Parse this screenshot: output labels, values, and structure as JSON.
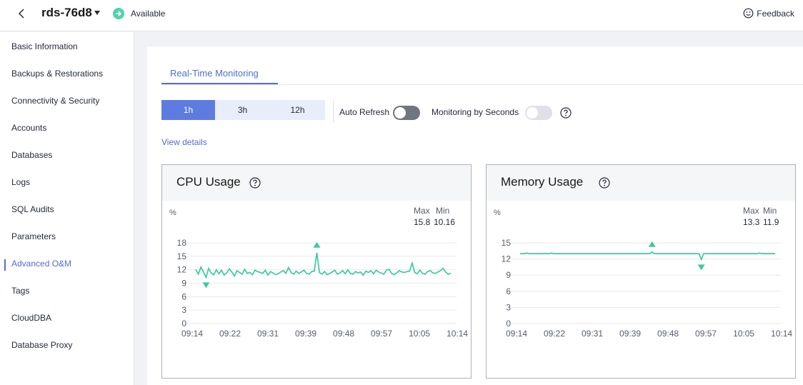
{
  "header": {
    "instance_name": "rds-76d8",
    "status": "Available",
    "feedback_label": "Feedback"
  },
  "sidebar": {
    "items": [
      {
        "label": "Basic Information"
      },
      {
        "label": "Backups & Restorations"
      },
      {
        "label": "Connectivity & Security"
      },
      {
        "label": "Accounts"
      },
      {
        "label": "Databases"
      },
      {
        "label": "Logs"
      },
      {
        "label": "SQL Audits"
      },
      {
        "label": "Parameters"
      },
      {
        "label": "Advanced O&M",
        "active": true
      },
      {
        "label": "Tags"
      },
      {
        "label": "CloudDBA"
      },
      {
        "label": "Database Proxy"
      }
    ]
  },
  "main": {
    "tab": "Real-Time Monitoring",
    "ranges": [
      "1h",
      "3h",
      "12h"
    ],
    "active_range": "1h",
    "auto_refresh_label": "Auto Refresh",
    "auto_refresh_on": false,
    "monitoring_by_seconds_label": "Monitoring by Seconds",
    "monitoring_by_seconds_enabled": false,
    "view_details_label": "View details"
  },
  "colors": {
    "accent": "#526ecc",
    "active_button": "#5e7ce0",
    "series": "#3ec9a0",
    "status_ok": "#50d4ab"
  },
  "chart_data": [
    {
      "type": "line",
      "title": "CPU Usage",
      "ylabel": "%",
      "max_label": "Max",
      "min_label": "Min",
      "max": "15.8",
      "min": "10.16",
      "ylim": [
        0,
        18
      ],
      "yticks": [
        0,
        3,
        6,
        9,
        12,
        15,
        18
      ],
      "xtick_labels": [
        "09:14",
        "09:22",
        "09:31",
        "09:39",
        "09:48",
        "09:57",
        "10:05",
        "10:14"
      ],
      "series": [
        {
          "values": [
            12.1,
            11.0,
            12.6,
            11.5,
            10.3,
            12.3,
            11.3,
            10.9,
            12.0,
            11.1,
            11.9,
            10.8,
            11.3,
            12.2,
            11.5,
            10.6,
            11.8,
            11.4,
            11.0,
            12.1,
            11.2,
            11.4,
            10.9,
            11.9,
            11.6,
            11.4,
            11.2,
            11.9,
            10.8,
            11.6,
            11.3,
            10.9,
            11.1,
            11.5,
            11.8,
            11.2,
            12.5,
            11.4,
            11.0,
            11.7,
            11.2,
            11.5,
            11.9,
            11.2,
            11.0,
            11.6,
            11.7,
            15.8,
            11.4,
            11.0,
            11.6,
            10.9,
            11.2,
            11.5,
            11.9,
            11.0,
            11.3,
            11.8,
            11.1,
            12.0,
            11.2,
            11.0,
            11.6,
            11.3,
            11.5,
            10.8,
            11.7,
            11.4,
            11.8,
            11.1,
            11.9,
            11.5,
            11.3,
            11.0,
            11.9,
            12.1,
            11.2,
            10.9,
            11.3,
            11.8,
            11.5,
            11.4,
            11.6,
            11.7,
            13.5,
            11.4,
            11.1,
            11.9,
            11.2,
            11.0,
            11.6,
            11.8,
            11.3,
            11.2,
            11.5,
            11.8,
            12.3,
            11.5,
            11.0,
            11.2
          ]
        }
      ],
      "max_index": 47,
      "min_index": 4
    },
    {
      "type": "line",
      "title": "Memory Usage",
      "ylabel": "%",
      "max_label": "Max",
      "min_label": "Min",
      "max": "13.3",
      "min": "11.9",
      "ylim": [
        0,
        15
      ],
      "yticks": [
        0,
        3,
        6,
        9,
        12,
        15
      ],
      "xtick_labels": [
        "09:14",
        "09:22",
        "09:31",
        "09:39",
        "09:48",
        "09:57",
        "10:05",
        "10:14"
      ],
      "series": [
        {
          "values": [
            13.0,
            13.0,
            13.0,
            13.1,
            13.0,
            13.0,
            13.0,
            13.0,
            13.0,
            13.0,
            13.0,
            13.0,
            13.0,
            13.0,
            13.1,
            13.0,
            13.0,
            13.0,
            13.0,
            13.0,
            13.0,
            13.0,
            13.0,
            13.0,
            13.0,
            13.0,
            13.0,
            13.0,
            13.0,
            13.0,
            13.0,
            13.0,
            13.0,
            13.0,
            13.0,
            13.0,
            13.0,
            13.0,
            13.0,
            13.0,
            13.0,
            13.0,
            13.0,
            13.0,
            13.0,
            13.0,
            13.0,
            13.0,
            13.0,
            13.0,
            13.0,
            13.0,
            13.0,
            13.0,
            13.0,
            13.0,
            13.0,
            13.0,
            13.0,
            13.3,
            13.0,
            13.0,
            13.0,
            13.0,
            13.0,
            13.0,
            13.0,
            13.0,
            13.0,
            13.0,
            13.0,
            13.0,
            13.0,
            13.0,
            13.0,
            13.0,
            13.0,
            13.0,
            13.0,
            13.0,
            13.0,
            11.9,
            13.0,
            13.0,
            13.0,
            13.0,
            13.0,
            13.0,
            13.0,
            13.0,
            13.0,
            13.0,
            13.0,
            13.0,
            13.0,
            13.0,
            13.0,
            13.0,
            13.0,
            13.0,
            13.0,
            13.0,
            13.0,
            13.0,
            13.0,
            13.0,
            13.0,
            13.1,
            13.0,
            13.0,
            13.0,
            13.0,
            13.0,
            13.0,
            13.0
          ]
        }
      ],
      "max_index": 59,
      "min_index": 81
    }
  ]
}
